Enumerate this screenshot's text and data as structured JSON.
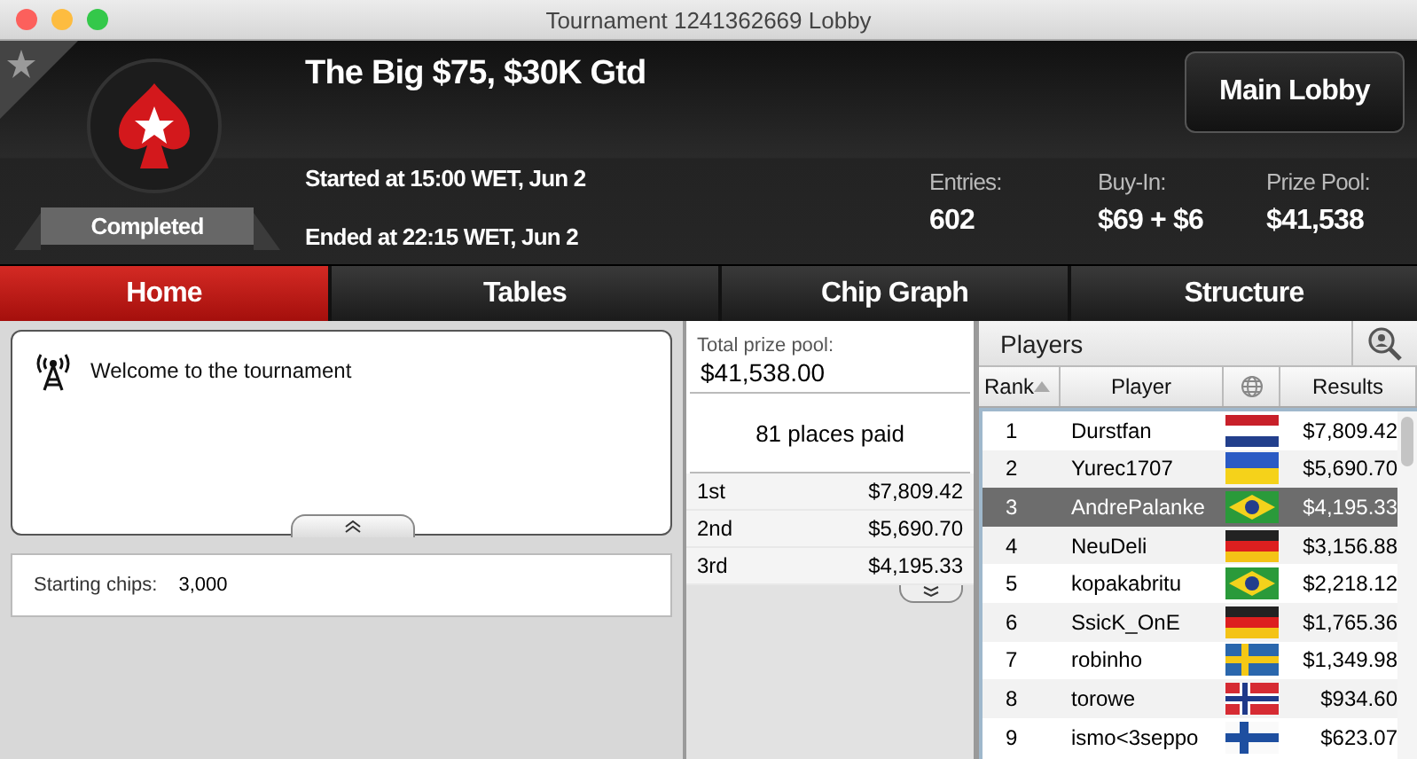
{
  "window": {
    "title": "Tournament 1241362669 Lobby"
  },
  "header": {
    "title": "The Big $75, $30K Gtd",
    "status": "Completed",
    "started": "Started at 15:00 WET, Jun 2",
    "ended": "Ended at 22:15 WET, Jun 2",
    "main_lobby_button": "Main Lobby",
    "stats": [
      {
        "label": "Entries:",
        "value": "602"
      },
      {
        "label": "Buy-In:",
        "value": "$69 + $6"
      },
      {
        "label": "Prize Pool:",
        "value": "$41,538"
      }
    ]
  },
  "tabs": [
    {
      "label": "Home",
      "selected": true
    },
    {
      "label": "Tables",
      "selected": false
    },
    {
      "label": "Chip Graph",
      "selected": false
    },
    {
      "label": "Structure",
      "selected": false
    }
  ],
  "news": {
    "message": "Welcome to the tournament"
  },
  "starting_chips": {
    "label": "Starting chips:",
    "value": "3,000"
  },
  "prizes": {
    "total_label": "Total prize pool:",
    "total": "$41,538.00",
    "places_paid": "81 places paid",
    "rows": [
      {
        "place": "1st",
        "amount": "$7,809.42"
      },
      {
        "place": "2nd",
        "amount": "$5,690.70"
      },
      {
        "place": "3rd",
        "amount": "$4,195.33"
      }
    ]
  },
  "players": {
    "title": "Players",
    "columns": [
      {
        "kind": "text",
        "label": "Rank",
        "sorted": true
      },
      {
        "kind": "text",
        "label": "Player",
        "sorted": false
      },
      {
        "kind": "globe",
        "sorted": false
      },
      {
        "kind": "text",
        "label": "Results",
        "sorted": false
      }
    ],
    "rows": [
      {
        "rank": "1",
        "name": "Durstfan",
        "kind": "nl",
        "result": "$7,809.42",
        "selected": false
      },
      {
        "rank": "2",
        "name": "Yurec1707",
        "kind": "ua",
        "result": "$5,690.70",
        "selected": false
      },
      {
        "rank": "3",
        "name": "AndrePalanke",
        "kind": "br",
        "result": "$4,195.33",
        "selected": true
      },
      {
        "rank": "4",
        "name": "NeuDeli",
        "kind": "de",
        "result": "$3,156.88",
        "selected": false
      },
      {
        "rank": "5",
        "name": "kopakabritu",
        "kind": "br",
        "result": "$2,218.12",
        "selected": false
      },
      {
        "rank": "6",
        "name": "SsicK_OnE",
        "kind": "de",
        "result": "$1,765.36",
        "selected": false
      },
      {
        "rank": "7",
        "name": "robinho",
        "kind": "se",
        "result": "$1,349.98",
        "selected": false
      },
      {
        "rank": "8",
        "name": "torowe",
        "kind": "no",
        "result": "$934.60",
        "selected": false
      },
      {
        "rank": "9",
        "name": "ismo<3seppo",
        "kind": "fi",
        "result": "$623.07",
        "selected": false
      }
    ]
  }
}
